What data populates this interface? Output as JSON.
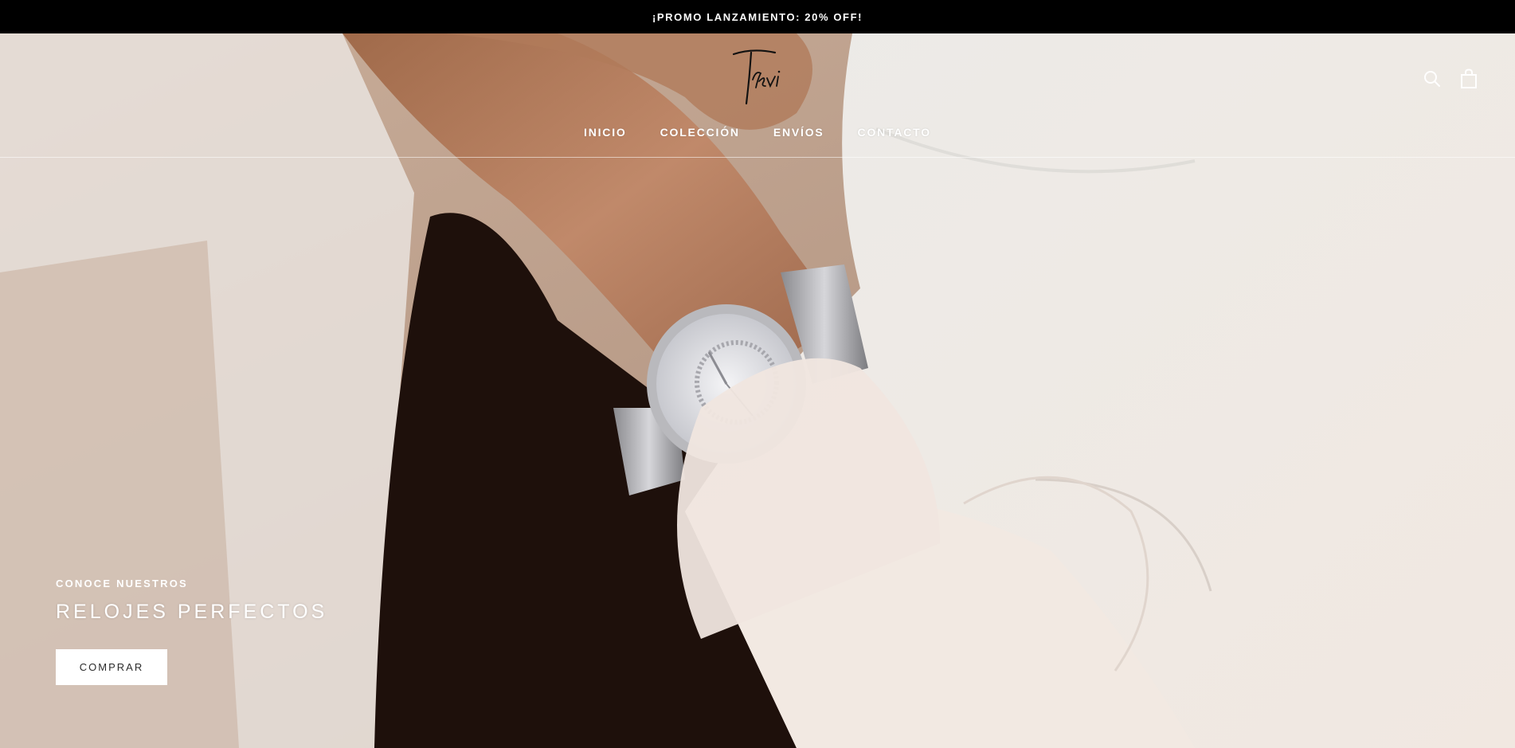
{
  "announcement": {
    "text": "¡PROMO LANZAMIENTO: 20% OFF!"
  },
  "header": {
    "logo_text": "Trevi",
    "nav": [
      {
        "label": "INICIO"
      },
      {
        "label": "COLECCIÓN"
      },
      {
        "label": "ENVÍOS"
      },
      {
        "label": "CONTACTO"
      }
    ],
    "icons": [
      "search-icon",
      "shopping-bag-icon"
    ]
  },
  "hero": {
    "kicker": "CONOCE NUESTROS",
    "title": "RELOJES PERFECTOS",
    "cta_label": "COMPRAR"
  },
  "colors": {
    "announcement_bg": "#000000",
    "text_light": "#ffffff",
    "cta_bg": "#ffffff",
    "cta_text": "#2b2b2b"
  }
}
